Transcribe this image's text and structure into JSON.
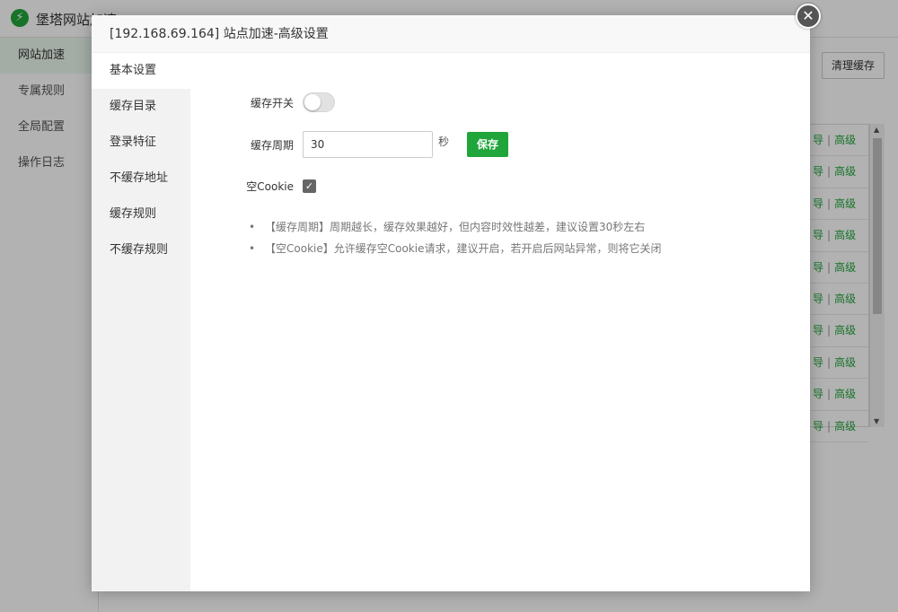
{
  "background": {
    "app_title": "堡塔网站加速",
    "sidebar": [
      "网站加速",
      "专属规则",
      "全局配置",
      "操作日志"
    ],
    "clear_cache_label": "清理缓存",
    "row_link_1": "导",
    "row_sep": "|",
    "row_link_2": "高级",
    "row_count": 10
  },
  "modal": {
    "title": "[192.168.69.164] 站点加速-高级设置",
    "close_glyph": "✕",
    "nav": [
      "基本设置",
      "缓存目录",
      "登录特征",
      "不缓存地址",
      "缓存规则",
      "不缓存规则"
    ],
    "active_nav": 0,
    "form": {
      "cache_switch_label": "缓存开关",
      "cache_switch_on": false,
      "cache_period_label": "缓存周期",
      "cache_period_value": "30",
      "cache_period_unit": "秒",
      "save_label": "保存",
      "empty_cookie_label": "空Cookie",
      "empty_cookie_checked": true,
      "check_glyph": "✓"
    },
    "tips": [
      "【缓存周期】周期越长，缓存效果越好，但内容时效性越差，建议设置30秒左右",
      "【空Cookie】允许缓存空Cookie请求，建议开启，若开启后网站异常，则将它关闭"
    ]
  },
  "colors": {
    "accent": "#20a53a",
    "overlay": "rgba(0,0,0,0.3)"
  }
}
